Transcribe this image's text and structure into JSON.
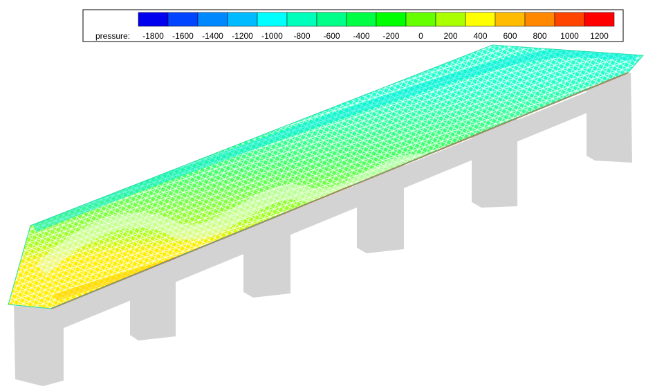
{
  "legend": {
    "variable_label": "pressure:",
    "tick_labels": [
      "-1800",
      "-1600",
      "-1400",
      "-1200",
      "-1000",
      "-800",
      "-600",
      "-400",
      "-200",
      "0",
      "200",
      "400",
      "600",
      "800",
      "1000",
      "1200"
    ],
    "colors": [
      "#0000ee",
      "#0044ff",
      "#0088ff",
      "#00bbff",
      "#00ffff",
      "#00ffbb",
      "#00ff88",
      "#00ff44",
      "#00ff00",
      "#66ff00",
      "#aaff00",
      "#ffff00",
      "#ffbb00",
      "#ff8800",
      "#ff4400",
      "#ff0000"
    ]
  },
  "model": {
    "mesh_base_color": "#33ee55",
    "support_color": "#d3d3d3",
    "edge_color": "#ff3300"
  }
}
